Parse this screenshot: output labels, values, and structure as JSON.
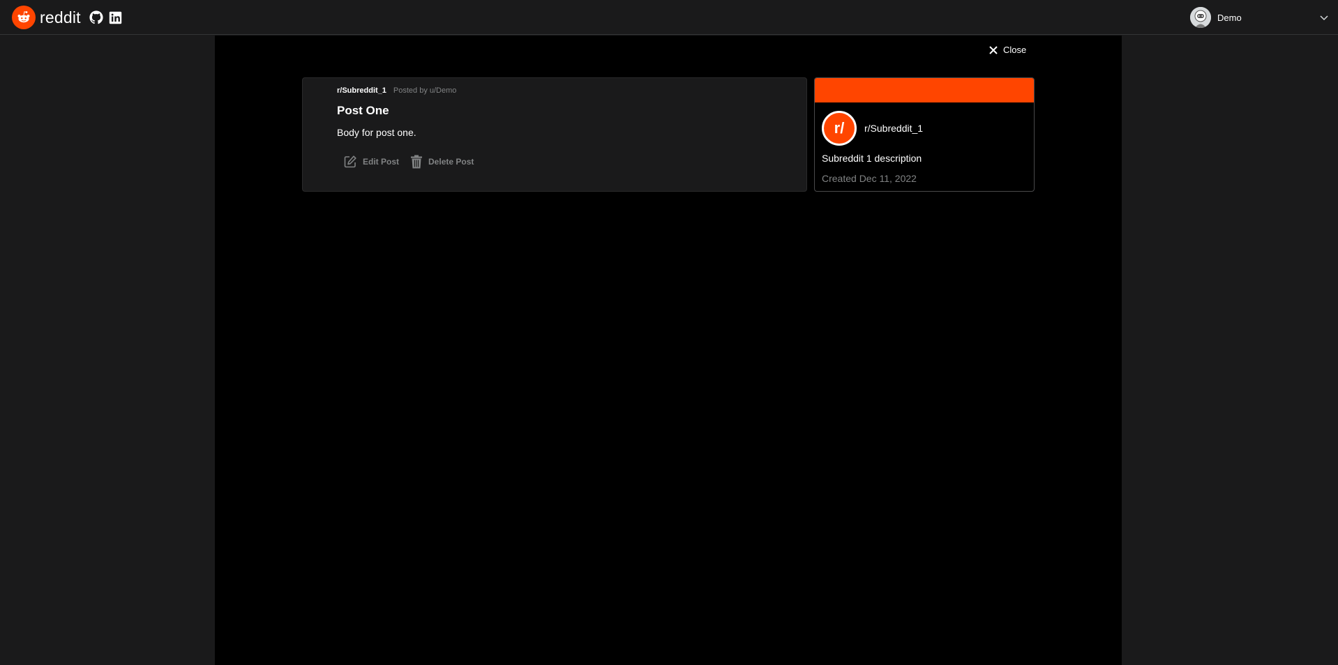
{
  "header": {
    "brand_name": "reddit",
    "brand_color": "#ff4500",
    "icons": [
      "reddit-logo-icon",
      "github-icon",
      "linkedin-icon"
    ],
    "user": {
      "name": "Demo",
      "menu_icon": "chevron-down-icon"
    }
  },
  "modal": {
    "close_label": "Close"
  },
  "post": {
    "subreddit": "r/Subreddit_1",
    "posted_by": "Posted by u/Demo",
    "title": "Post One",
    "body": "Body for post one.",
    "edit_label": "Edit Post",
    "delete_label": "Delete Post"
  },
  "community": {
    "icon_text": "r/",
    "name": "r/Subreddit_1",
    "description": "Subreddit 1 description",
    "created": "Created Dec 11, 2022",
    "banner_color": "#ff4500"
  }
}
